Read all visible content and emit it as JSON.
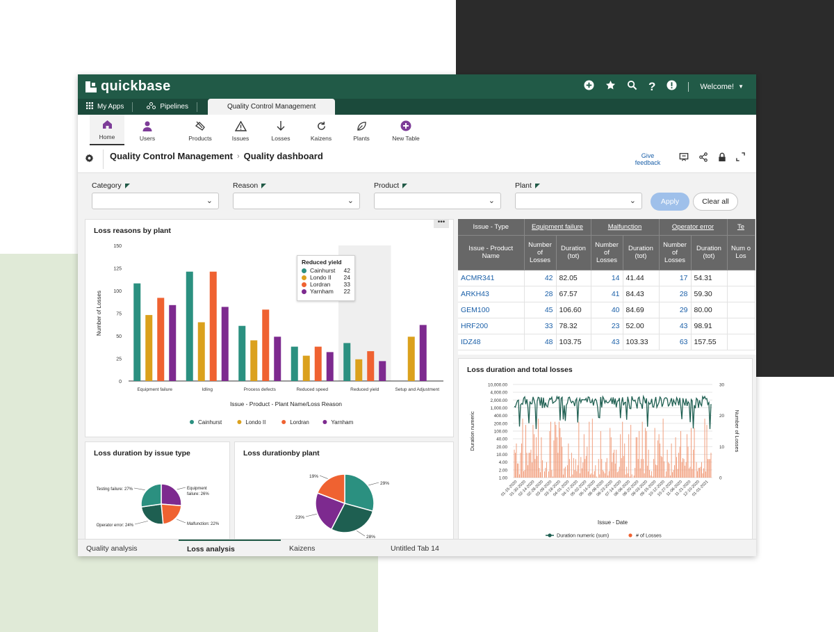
{
  "brand": {
    "name": "quickbase"
  },
  "topbar": {
    "welcome": "Welcome!",
    "icons": [
      "plus-circle-icon",
      "star-icon",
      "search-icon",
      "help-icon",
      "alert-icon"
    ]
  },
  "appnav": {
    "my_apps": "My Apps",
    "pipelines": "Pipelines",
    "active_app": "Quality Control Management"
  },
  "tables": [
    {
      "label": "Home",
      "icon": "home-icon"
    },
    {
      "label": "Users",
      "icon": "user-icon"
    },
    {
      "label": "Products",
      "icon": "products-icon"
    },
    {
      "label": "Issues",
      "icon": "warning-icon"
    },
    {
      "label": "Losses",
      "icon": "arrow-down-icon"
    },
    {
      "label": "Kaizens",
      "icon": "refresh-icon"
    },
    {
      "label": "Plants",
      "icon": "leaf-icon"
    },
    {
      "label": "New Table",
      "icon": "plus-circle-icon"
    }
  ],
  "breadcrumb": {
    "app": "Quality Control Management",
    "page": "Quality dashboard"
  },
  "feedback": {
    "line1": "Give",
    "line2": "feedback"
  },
  "filters": {
    "items": [
      {
        "label": "Category",
        "value": ""
      },
      {
        "label": "Reason",
        "value": ""
      },
      {
        "label": "Product",
        "value": ""
      },
      {
        "label": "Plant",
        "value": ""
      }
    ],
    "apply": "Apply",
    "clear": "Clear all"
  },
  "panels": {
    "loss_reasons": "Loss reasons by plant",
    "duration_issue": "Loss duration by issue type",
    "duration_plant": "Loss durationby plant",
    "duration_total": "Loss duration and total losses"
  },
  "table": {
    "group_headers": [
      "Issue - Type",
      "Equipment failure",
      "Malfunction",
      "Operator error",
      "Te"
    ],
    "sub_headers": [
      "Issue - Product Name",
      "Number of Losses",
      "Duration (tot)",
      "Number of Losses",
      "Duration (tot)",
      "Number of Losses",
      "Duration (tot)",
      "Num o Los"
    ],
    "rows": [
      {
        "name": "ACMR341",
        "cells": [
          "42",
          "82.05",
          "14",
          "41.44",
          "17",
          "54.31"
        ]
      },
      {
        "name": "ARKH43",
        "cells": [
          "28",
          "67.57",
          "41",
          "84.43",
          "28",
          "59.30"
        ]
      },
      {
        "name": "GEM100",
        "cells": [
          "45",
          "106.60",
          "40",
          "84.69",
          "29",
          "80.00"
        ]
      },
      {
        "name": "HRF200",
        "cells": [
          "33",
          "78.32",
          "23",
          "52.00",
          "43",
          "98.91"
        ]
      },
      {
        "name": "IDZ48",
        "cells": [
          "48",
          "103.75",
          "43",
          "103.33",
          "63",
          "157.55"
        ]
      }
    ]
  },
  "tooltip": {
    "title": "Reduced yield",
    "rows": [
      {
        "name": "Cainhurst",
        "value": "42"
      },
      {
        "name": "Londo II",
        "value": "24"
      },
      {
        "name": "Lordran",
        "value": "33"
      },
      {
        "name": "Yarnham",
        "value": "22"
      }
    ]
  },
  "bottom_tabs": [
    {
      "label": "Quality analysis"
    },
    {
      "label": "Loss analysis"
    },
    {
      "label": "Kaizens"
    },
    {
      "label": "Untitled Tab 14"
    }
  ],
  "colors": {
    "green": "#2b9080",
    "gold": "#dba11d",
    "orange": "#ef6231",
    "purple": "#7d2a8f",
    "header": "#215a47"
  },
  "chart_data": [
    {
      "type": "bar",
      "title": "Loss reasons by plant",
      "xlabel": "Issue - Product - Plant Name/Loss Reason",
      "ylabel": "Number of Losses",
      "ylim": [
        0,
        150
      ],
      "yticks": [
        0,
        25,
        50,
        75,
        100,
        125,
        150
      ],
      "categories": [
        "Equipment failure",
        "Idling",
        "Process defects",
        "Reduced speed",
        "Reduced yield",
        "Setup and Adjustment"
      ],
      "series": [
        {
          "name": "Cainhurst",
          "values": [
            108,
            121,
            61,
            38,
            42,
            null
          ]
        },
        {
          "name": "Londo II",
          "values": [
            73,
            65,
            45,
            28,
            24,
            49
          ]
        },
        {
          "name": "Lordran",
          "values": [
            92,
            121,
            79,
            38,
            33,
            null
          ]
        },
        {
          "name": "Yarnham",
          "values": [
            84,
            82,
            49,
            32,
            22,
            62
          ]
        }
      ],
      "legend": "bottom"
    },
    {
      "type": "pie",
      "title": "Loss duration by issue type",
      "slices": [
        {
          "label": "Equipment failure",
          "value": 26
        },
        {
          "label": "Malfunction",
          "value": 22
        },
        {
          "label": "Operator error",
          "value": 24
        },
        {
          "label": "Testing failure",
          "value": 27
        }
      ],
      "slice_texts": [
        "Equipment failure: 26%",
        "Malfunction: 22%",
        "Operator error: 24%",
        "Testing failure: 27%"
      ]
    },
    {
      "type": "pie",
      "title": "Loss durationby plant",
      "slices": [
        {
          "label": "Cainhurst",
          "value": 29
        },
        {
          "label": "Londo II",
          "value": 28
        },
        {
          "label": "Yarnham",
          "value": 23
        },
        {
          "label": "Lordran",
          "value": 19
        }
      ],
      "slice_texts": [
        "29%",
        "28%",
        "23%",
        "19%"
      ]
    },
    {
      "type": "line",
      "title": "Loss duration and total losses",
      "xlabel": "Issue - Date",
      "ylabel": "Duration numeric",
      "y2label": "Number of Losses",
      "yscale": "log",
      "yticks": [
        "10,000.00",
        "4,000.00",
        "2,000.00",
        "1,000.00",
        "400.00",
        "200.00",
        "100.00",
        "40.00",
        "20.00",
        "10.00",
        "4.00",
        "2.00",
        "1.00"
      ],
      "y2ticks": [
        "30",
        "20",
        "10",
        "0"
      ],
      "xticks": [
        "01-15-2020",
        "01-30-2020",
        "02-14-2020",
        "02-28-2020",
        "03-09-2020",
        "03-18-2020",
        "04-01-2020",
        "04-17-2020",
        "05-02-2020",
        "05-14-2020",
        "06-08-2020",
        "06-23-2020",
        "07-14-2020",
        "08-06-2020",
        "08-20-2020",
        "09-03-2020",
        "09-15-2020",
        "10-12-2020",
        "10-27-2020",
        "11-06-2020",
        "11-21-2020",
        "12-10-2020",
        "01-01-2021"
      ],
      "series": [
        {
          "name": "Duration numeric (sum)",
          "axis": "left",
          "typical_range": [
            800,
            3000
          ]
        },
        {
          "name": "# of Losses",
          "axis": "right",
          "typical_range": [
            0,
            20
          ]
        }
      ],
      "legend": "bottom"
    }
  ]
}
